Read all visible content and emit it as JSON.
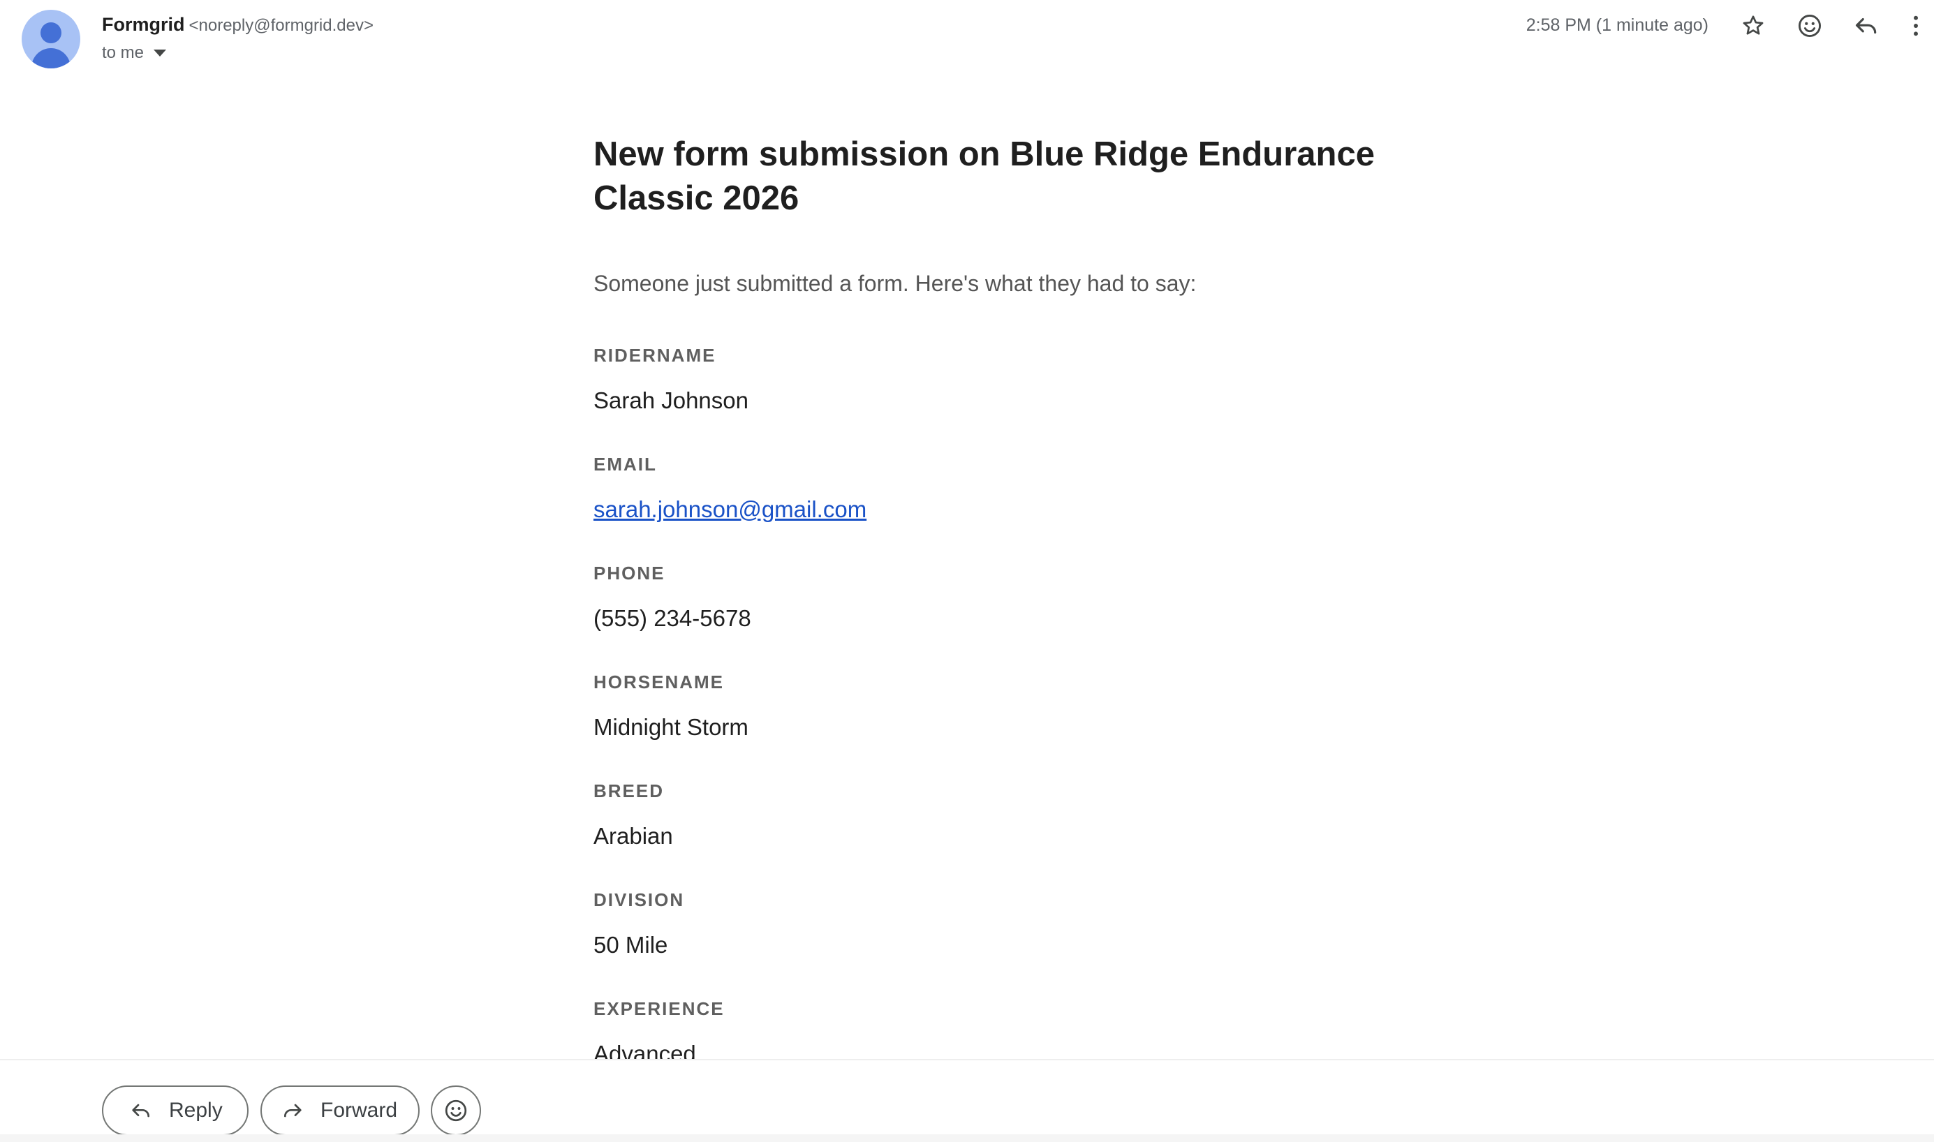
{
  "header": {
    "sender_name": "Formgrid",
    "sender_email": "<noreply@formgrid.dev>",
    "recipient": "to me",
    "timestamp": "2:58 PM (1 minute ago)"
  },
  "icons": {
    "avatar": "avatar-person-icon",
    "star": "star-icon",
    "emoji": "emoji-smile-icon",
    "reply": "reply-icon",
    "more": "more-vertical-icon",
    "forward": "forward-icon"
  },
  "email": {
    "title": "New form submission on Blue Ridge Endurance Classic 2026",
    "intro": "Someone just submitted a form. Here's what they had to say:",
    "fields": [
      {
        "label": "RIDERNAME",
        "value": "Sarah Johnson"
      },
      {
        "label": "EMAIL",
        "value": "sarah.johnson@gmail.com"
      },
      {
        "label": "PHONE",
        "value": "(555) 234-5678"
      },
      {
        "label": "HORSENAME",
        "value": "Midnight Storm"
      },
      {
        "label": "BREED",
        "value": "Arabian"
      },
      {
        "label": "DIVISION",
        "value": "50 Mile"
      },
      {
        "label": "EXPERIENCE",
        "value": "Advanced"
      }
    ]
  },
  "actions": {
    "reply_label": "Reply",
    "forward_label": "Forward"
  },
  "colors": {
    "link": "#1a52c7",
    "avatar_bg": "#a8c2f5",
    "avatar_fg": "#4470d6",
    "label": "#5f5f5f"
  }
}
